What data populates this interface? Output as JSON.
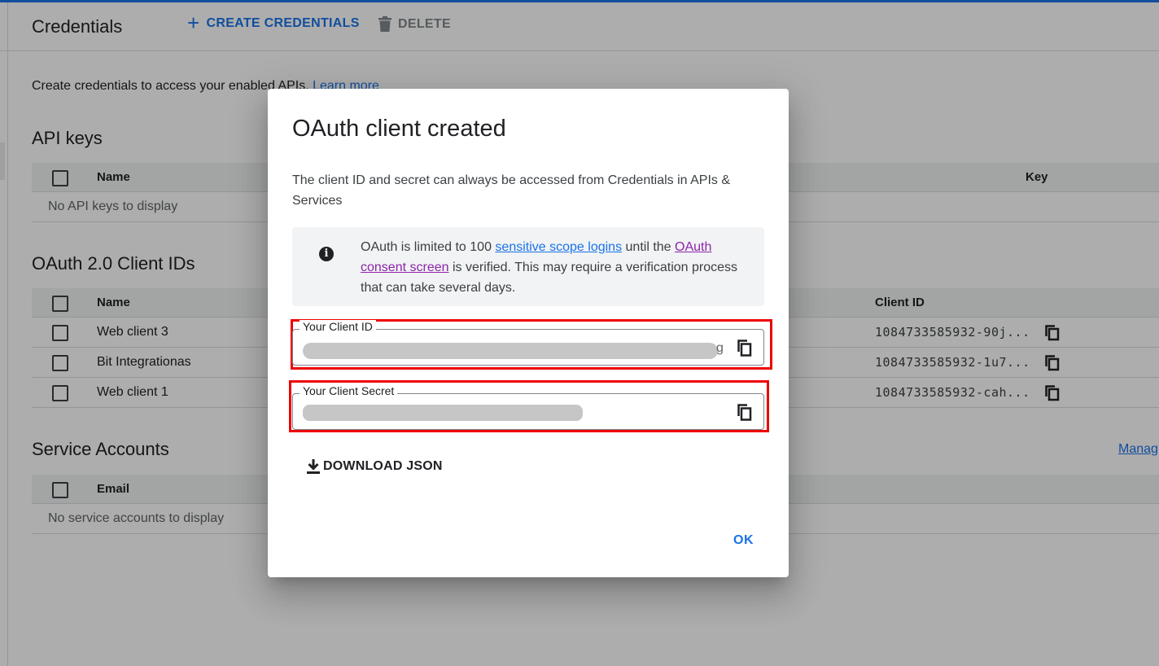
{
  "header": {
    "title": "Credentials",
    "create_label": "CREATE CREDENTIALS",
    "delete_label": "DELETE"
  },
  "intro": {
    "text": "Create credentials to access your enabled APIs.",
    "link": "Learn more"
  },
  "api_keys": {
    "title": "API keys",
    "columns": [
      "Name",
      "Key"
    ],
    "empty": "No API keys to display"
  },
  "oauth": {
    "title": "OAuth 2.0 Client IDs",
    "columns": [
      "Name",
      "Client ID"
    ],
    "rows": [
      {
        "name": "Web client 3",
        "client_id": "1084733585932-90j..."
      },
      {
        "name": "Bit Integrationas",
        "client_id": "1084733585932-1u7..."
      },
      {
        "name": "Web client 1",
        "client_id": "1084733585932-cah..."
      }
    ]
  },
  "service_accounts": {
    "title": "Service Accounts",
    "columns": [
      "Email"
    ],
    "empty": "No service accounts to display",
    "manage_link": "Manag"
  },
  "dialog": {
    "title": "OAuth client created",
    "description": "The client ID and secret can always be accessed from Credentials in APIs & Services",
    "info": {
      "text_1": "OAuth is limited to 100",
      "link_1": "sensitive scope logins",
      "text_2": "until the",
      "link_2": "OAuth consent screen",
      "text_3": "is verified. This may require a verification process that can take several days."
    },
    "client_id_label": "Your Client ID",
    "client_id_edge": "g",
    "client_secret_label": "Your Client Secret",
    "download_label": "DOWNLOAD JSON",
    "ok_label": "OK"
  },
  "colors": {
    "accent": "#1a73e8",
    "highlight": "#ee0000",
    "link_visited": "#8e24aa"
  }
}
